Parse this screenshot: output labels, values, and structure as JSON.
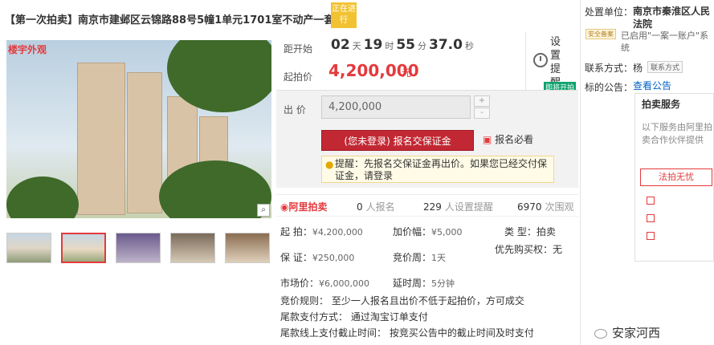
{
  "title": "【第一次拍卖】南京市建邺区云锦路88号5幢1单元1701室不动产一套",
  "stage_badge": "正在进行",
  "photo_label": "楼宇外观",
  "countdown": {
    "label": "距开始",
    "days": "02",
    "days_unit": "天",
    "hours": "19",
    "hours_unit": "时",
    "minutes": "55",
    "minutes_unit": "分",
    "seconds": "37.0",
    "seconds_unit": "秒"
  },
  "start_price": {
    "label": "起拍价",
    "value": "4,200,000",
    "unit": "元"
  },
  "remind": {
    "label": "设置提醒",
    "badge": "即将开拍"
  },
  "bid": {
    "label": "出 价",
    "value": "4,200,000",
    "up": "+",
    "down": "-"
  },
  "register_button": "(您未登录) 报名交保证金",
  "notice_link": "报名必看",
  "tip": {
    "prefix": "提醒：",
    "text": "先报名交保证金再出价。如果您已经交付保证金，请登录"
  },
  "stats": {
    "logo": "阿里拍卖",
    "enrolled_count": "0",
    "enrolled_label": "人报名",
    "reminder_count": "229",
    "reminder_label": "人设置提醒",
    "views_count": "6970",
    "views_label": "次围观"
  },
  "info": {
    "start_label": "起  拍：",
    "start_value": "¥4,200,000",
    "increment_label": "加价幅：",
    "increment_value": "¥5,000",
    "type_label": "类  型：",
    "type_value": "拍卖",
    "deposit_label": "保  证：",
    "deposit_value": "¥250,000",
    "cycle_label": "竞价周：",
    "cycle_value": "1天",
    "priority_label": "优先购买权：",
    "priority_value": "无",
    "market_label": "市场价：",
    "market_value": "¥6,000,000",
    "delay_label": "延时周：",
    "delay_value": "5分钟",
    "rule": "竞价规则：  至少一人报名且出价不低于起拍价，方可成交",
    "pay_method": "尾款支付方式：  通过淘宝订单支付",
    "pay_deadline": "尾款线上支付截止时间：  按竞买公告中的截止时间及时支付"
  },
  "right": {
    "court_label": "处置单位：",
    "court_name": "南京市秦淮区人民法院",
    "safe_badge": "安全备案",
    "system_text": "已启用\"一案一账户\"系统",
    "contact_label": "联系方式：",
    "contact_name": "杨",
    "contact_button": "联系方式",
    "notice_label": "标的公告：",
    "notice_link": "查看公告",
    "service_title": "拍卖服务",
    "service_text": "以下服务由阿里拍卖合作伙伴提供",
    "law_button": "法拍无忧"
  },
  "watermark": "安家河西",
  "colors": {
    "accent": "#e4393c",
    "button": "#c22833",
    "badge": "#f2c232",
    "remind_badge": "#0aa36b"
  }
}
